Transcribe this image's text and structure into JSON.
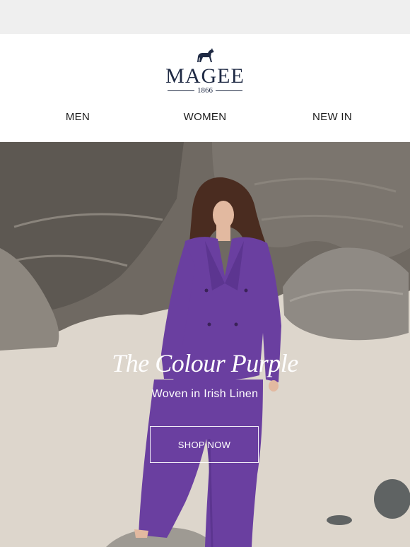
{
  "brand": {
    "name": "MAGEE",
    "year": "1866",
    "colors": {
      "navy": "#1f2a44"
    }
  },
  "nav": {
    "items": [
      {
        "label": "MEN"
      },
      {
        "label": "WOMEN"
      },
      {
        "label": "NEW IN"
      }
    ]
  },
  "hero": {
    "title": "The Colour Purple",
    "subtitle": "Woven in Irish Linen",
    "cta_label": "SHOP NOW",
    "colors": {
      "suit": "#6a3fa0",
      "sand": "#ddd6cc",
      "rock": "#6f6962"
    }
  },
  "icons": {
    "logo": "hound-icon"
  }
}
